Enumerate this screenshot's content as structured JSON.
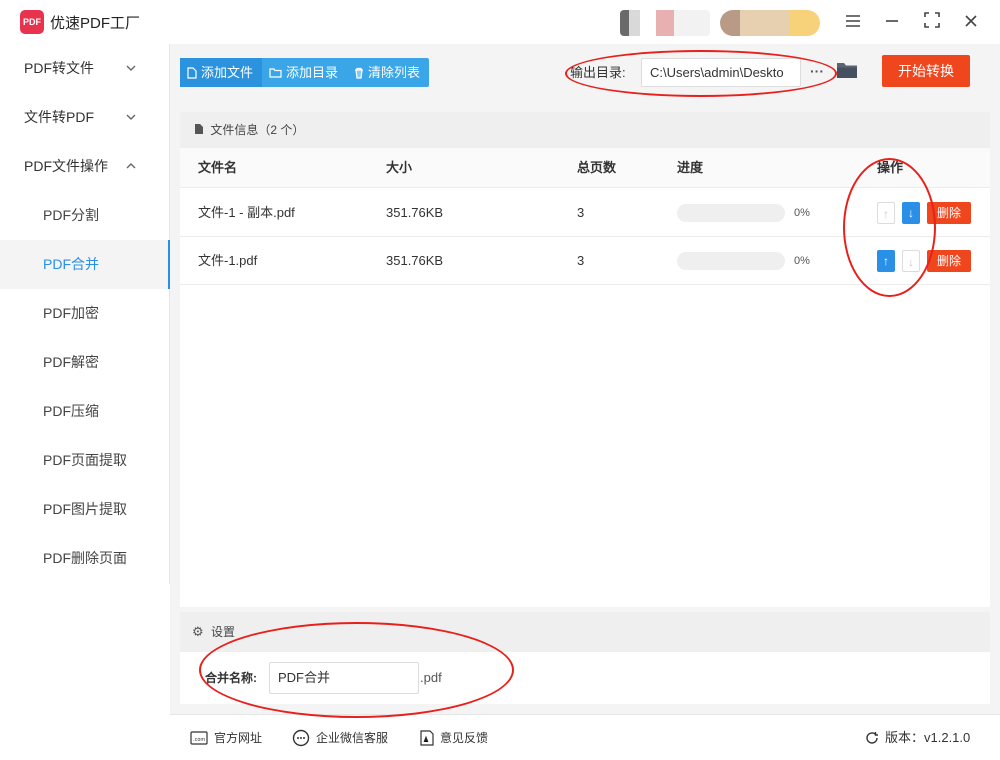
{
  "app": {
    "title": "优速PDF工厂",
    "logo_text": "PDF"
  },
  "colors": {
    "accent": "#2a8fe6",
    "danger": "#f0461e",
    "annotation": "#e8201b"
  },
  "sidebar": {
    "items": [
      {
        "label": "PDF转文件",
        "expanded": false
      },
      {
        "label": "文件转PDF",
        "expanded": false
      },
      {
        "label": "PDF文件操作",
        "expanded": true
      },
      {
        "label": "PDF分割"
      },
      {
        "label": "PDF合并",
        "active": true
      },
      {
        "label": "PDF加密"
      },
      {
        "label": "PDF解密"
      },
      {
        "label": "PDF压缩"
      },
      {
        "label": "PDF页面提取"
      },
      {
        "label": "PDF图片提取"
      },
      {
        "label": "PDF删除页面"
      }
    ]
  },
  "toolbar": {
    "add_file": "添加文件",
    "add_folder": "添加目录",
    "clear_list": "清除列表",
    "output_label": "输出目录:",
    "output_path": "C:\\Users\\admin\\Deskto",
    "more": "···",
    "start": "开始转换"
  },
  "file_panel": {
    "title": "文件信息（2 个）",
    "columns": [
      "文件名",
      "大小",
      "总页数",
      "进度",
      "操作"
    ],
    "rows": [
      {
        "name": "文件-1 - 副本.pdf",
        "size": "351.76KB",
        "pages": "3",
        "progress": "0%",
        "progress_value": 0,
        "delete": "删除",
        "up_enabled": false,
        "down_enabled": true
      },
      {
        "name": "文件-1.pdf",
        "size": "351.76KB",
        "pages": "3",
        "progress": "0%",
        "progress_value": 0,
        "delete": "删除",
        "up_enabled": true,
        "down_enabled": false
      }
    ]
  },
  "settings": {
    "title": "设置",
    "merge_label": "合并名称:",
    "merge_value": "PDF合并",
    "merge_ext": ".pdf"
  },
  "footer": {
    "website": "官方网址",
    "wechat": "企业微信客服",
    "feedback": "意见反馈",
    "version": "版本：v1.2.1.0"
  }
}
